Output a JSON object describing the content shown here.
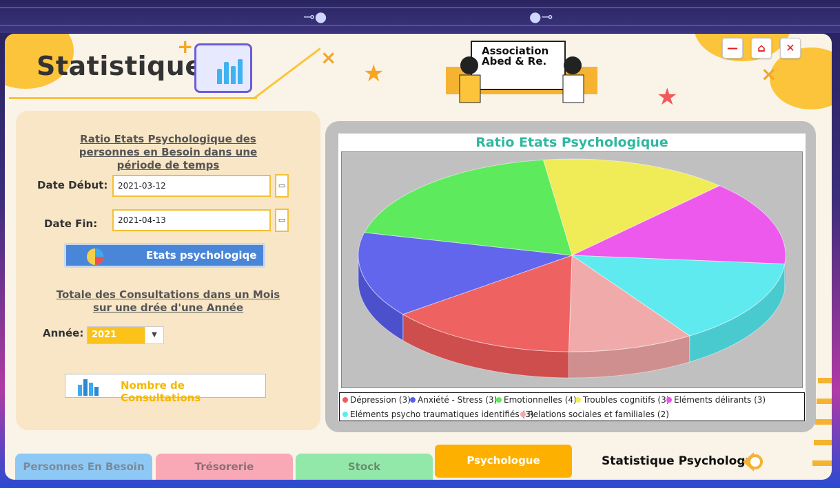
{
  "header": {
    "title": "Statistique",
    "logo_text": "Association Abed & Re."
  },
  "window_controls": {
    "minimize": "—",
    "home": "⌂",
    "close": "✕"
  },
  "left_panel": {
    "ratio_heading": "Ratio Etats Psychologique des personnes en Besoin dans une période de temps",
    "date_debut_label": "Date Début:",
    "date_debut_value": "2021-03-12",
    "date_fin_label": "Date Fin:",
    "date_fin_value": "2021-04-13",
    "etats_button": "Etats psychologiqe",
    "consult_heading": "Totale des Consultations dans un Mois sur une drée d'une Année",
    "annee_label": "Année:",
    "annee_value": "2021",
    "consultations_button": "Nombre de Consultations"
  },
  "chart_data": {
    "type": "pie",
    "title": "Ratio Etats Psychologique",
    "three_d": true,
    "slices": [
      {
        "label": "Dépression",
        "value": 3,
        "color": "#f25a5a"
      },
      {
        "label": "Anxiété - Stress",
        "value": 3,
        "color": "#5a5ef0"
      },
      {
        "label": "Emotionnelles",
        "value": 4,
        "color": "#55ee55"
      },
      {
        "label": "Troubles cognitifs",
        "value": 3,
        "color": "#f3f04e"
      },
      {
        "label": "Eléments délirants",
        "value": 3,
        "color": "#f050f0"
      },
      {
        "label": "Eléments psycho traumatiques identifiés",
        "value": 3,
        "color": "#56eef2"
      },
      {
        "label": "Relations sociales et familiales",
        "value": 2,
        "color": "#f5a8a8"
      }
    ],
    "legend_entries": [
      "Dépression (3)",
      "Anxiété - Stress (3)",
      "Emotionnelles (4)",
      "Troubles cognitifs (3)",
      "Eléments délirants (3)",
      "Eléments psycho traumatiques identifiés (3)",
      "Relations sociales et familiales (2)"
    ],
    "legend_position": "bottom"
  },
  "tabs": [
    {
      "label": "Personnes En Besoin",
      "color": "#8ec9f5",
      "text_color": "#7a8a99"
    },
    {
      "label": "Trésorerie",
      "color": "#f9a9b6",
      "text_color": "#8a7075"
    },
    {
      "label": "Stock",
      "color": "#92e8a8",
      "text_color": "#6d8b74"
    },
    {
      "label": "Psychologue",
      "color": "#fdb000",
      "text_color": "#ffffff"
    }
  ],
  "footer": {
    "section_title": "Statistique Psychologue"
  }
}
